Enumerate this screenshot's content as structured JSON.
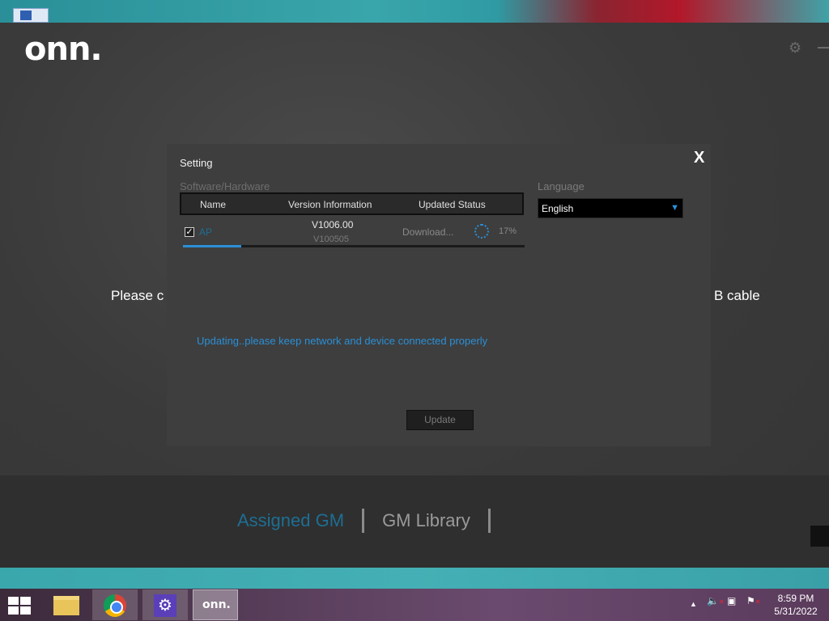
{
  "app": {
    "logo": "onn.",
    "background_message_left": "Please c",
    "background_message_right": "B cable",
    "nav": {
      "assigned": "Assigned GM",
      "library": "GM Library"
    }
  },
  "dialog": {
    "title": "Setting",
    "close": "X",
    "section_label": "Software/Hardware",
    "columns": [
      "Name",
      "Version Information",
      "Updated Status"
    ],
    "rows": [
      {
        "checked": true,
        "name": "AP",
        "version_new": "V1006.00",
        "version_old": "V100505",
        "status": "Download...",
        "percent": "17%",
        "progress": 0.17
      }
    ],
    "language_label": "Language",
    "language_value": "English",
    "message": "Updating..please keep network and device connected properly",
    "update_button": "Update"
  },
  "taskbar": {
    "items": [
      "file-explorer",
      "chrome",
      "settings",
      "onn"
    ],
    "onn_label": "onn.",
    "time": "8:59 PM",
    "date": "5/31/2022"
  },
  "colors": {
    "accent": "#2a8fd6",
    "nav_active": "#1d6e93"
  }
}
